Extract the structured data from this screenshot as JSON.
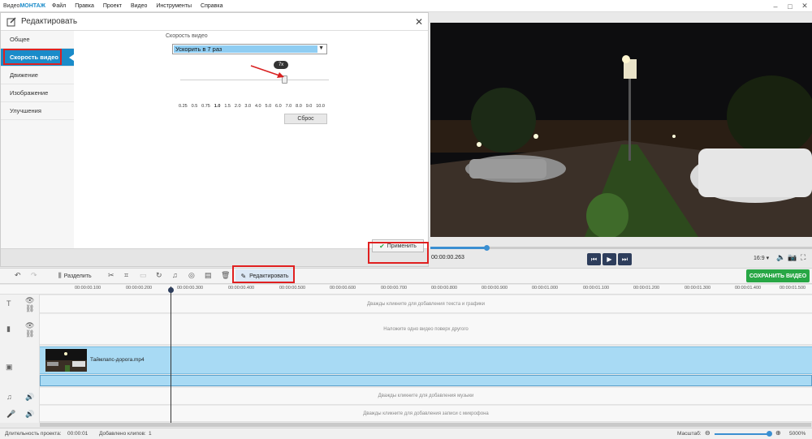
{
  "app": {
    "brand_prefix": "Видео",
    "brand_suffix": "МОНТАЖ"
  },
  "menu": [
    "Файл",
    "Правка",
    "Проект",
    "Видео",
    "Инструменты",
    "Справка"
  ],
  "edit_panel": {
    "title": "Редактировать",
    "nav": [
      "Общее",
      "Скорость видео",
      "Движение",
      "Изображение",
      "Улучшения"
    ],
    "active_nav": 1,
    "speed_label": "Скорость видео",
    "speed_select": "Ускорить в 7 раз",
    "slider_tooltip": "7x",
    "slider_value": 7.0,
    "scale": [
      "0.25",
      "0.5",
      "0.75",
      "1.0",
      "1.5",
      "2.0",
      "3.0",
      "4.0",
      "5.0",
      "6.0",
      "7.0",
      "8.0",
      "9.0",
      "10.0"
    ],
    "reset": "Сброс",
    "apply": "Применить"
  },
  "player": {
    "timecode": "00:00:00.263",
    "progress": 0.147,
    "aspect": "16:9"
  },
  "toolbar": {
    "split": "Разделить",
    "edit": "Редактировать",
    "save": "СОХРАНИТЬ ВИДЕО"
  },
  "ruler": [
    "00:00:00.100",
    "00:00:00.200",
    "00:00:00.300",
    "00:00:00.400",
    "00:00:00.500",
    "00:00:00.600",
    "00:00:00.700",
    "00:00:00.800",
    "00:00:00.900",
    "00:00:01.000",
    "00:00:01.100",
    "00:00:01.200",
    "00:00:01.300",
    "00:00:01.400",
    "00:00:01.500"
  ],
  "tracks": {
    "text_hint": "Дважды кликните для добавления текста и графики",
    "overlay_hint": "Наложите одно видео поверх другого",
    "clip_name": "Таймлапс-дорога.mp4",
    "music_hint": "Дважды кликните для добавления музыки",
    "mic_hint": "Дважды кликните для добавления записи с микрофона"
  },
  "status": {
    "duration_label": "Длительность проекта:",
    "duration": "00:00:01",
    "clips_label": "Добавлено клипов:",
    "clips": "1",
    "zoom_label": "Масштаб:",
    "zoom": "5000%"
  },
  "colors": {
    "accent": "#1a8bc9",
    "save": "#28a745",
    "highlight": "#e02020",
    "clip": "#a8daf4"
  }
}
